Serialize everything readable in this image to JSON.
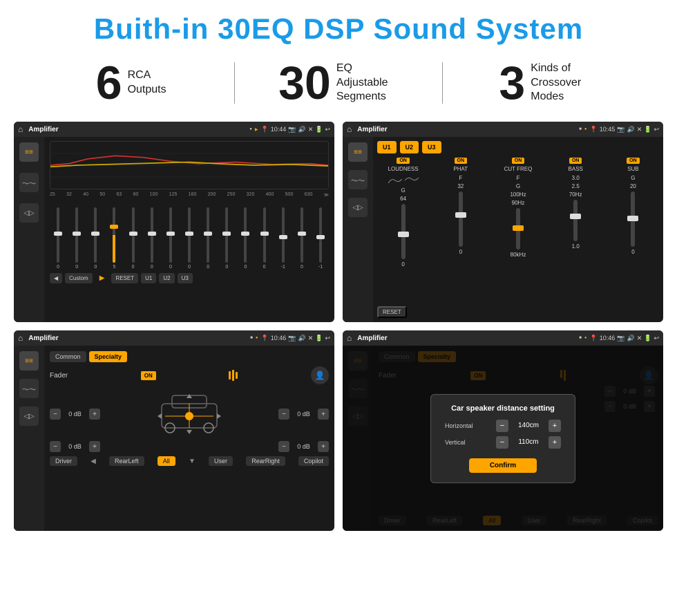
{
  "header": {
    "title": "Buith-in 30EQ DSP Sound System"
  },
  "stats": [
    {
      "number": "6",
      "text_line1": "RCA",
      "text_line2": "Outputs"
    },
    {
      "number": "30",
      "text_line1": "EQ Adjustable",
      "text_line2": "Segments"
    },
    {
      "number": "3",
      "text_line1": "Kinds of",
      "text_line2": "Crossover Modes"
    }
  ],
  "screens": {
    "eq": {
      "status": {
        "app": "Amplifier",
        "time": "10:44"
      },
      "freq_labels": [
        "25",
        "32",
        "40",
        "50",
        "63",
        "80",
        "100",
        "125",
        "160",
        "200",
        "250",
        "320",
        "400",
        "500",
        "630"
      ],
      "slider_values": [
        "0",
        "0",
        "0",
        "5",
        "0",
        "0",
        "0",
        "0",
        "0",
        "0",
        "0",
        "0",
        "-1",
        "0",
        "-1"
      ],
      "buttons": [
        "Custom",
        "RESET",
        "U1",
        "U2",
        "U3"
      ]
    },
    "mixer": {
      "status": {
        "app": "Amplifier",
        "time": "10:45"
      },
      "presets": [
        "U1",
        "U2",
        "U3"
      ],
      "channels": [
        {
          "label": "LOUDNESS",
          "on": true
        },
        {
          "label": "PHAT",
          "on": true
        },
        {
          "label": "CUT FREQ",
          "on": true
        },
        {
          "label": "BASS",
          "on": true
        },
        {
          "label": "SUB",
          "on": true
        }
      ],
      "reset_label": "RESET"
    },
    "fader": {
      "status": {
        "app": "Amplifier",
        "time": "10:46"
      },
      "tabs": [
        "Common",
        "Specialty"
      ],
      "active_tab": "Specialty",
      "fader_label": "Fader",
      "on_label": "ON",
      "controls": {
        "top_left_db": "0 dB",
        "top_right_db": "0 dB",
        "bot_left_db": "0 dB",
        "bot_right_db": "0 dB"
      },
      "bottom_buttons": [
        "Driver",
        "RearLeft",
        "All",
        "User",
        "RearRight",
        "Copilot"
      ]
    },
    "dialog": {
      "status": {
        "app": "Amplifier",
        "time": "10:46"
      },
      "tabs": [
        "Common",
        "Specialty"
      ],
      "active_tab": "Specialty",
      "on_label": "ON",
      "dialog": {
        "title": "Car speaker distance setting",
        "fields": [
          {
            "label": "Horizontal",
            "value": "140cm"
          },
          {
            "label": "Vertical",
            "value": "110cm"
          }
        ],
        "confirm_label": "Confirm"
      },
      "right_controls": {
        "top_db": "0 dB",
        "bot_db": "0 dB"
      },
      "bottom_buttons": [
        "Driver",
        "RearLeft",
        "All",
        "User",
        "RearRight",
        "Copilot"
      ]
    }
  }
}
